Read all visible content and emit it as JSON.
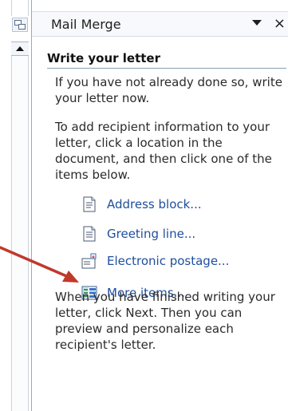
{
  "pane": {
    "title": "Mail Merge",
    "close_glyph": "×"
  },
  "section": {
    "title": "Write your letter"
  },
  "paragraphs": {
    "intro": "If you have not already done so, write your letter now.",
    "instructions": "To add recipient information to your letter, click a location in the document, and then click one of the items below.",
    "finish": "When you have finished writing your letter, click Next. Then you can preview and personalize each recipient's letter."
  },
  "items": [
    {
      "label": "Address block...",
      "icon": "address-block-icon"
    },
    {
      "label": "Greeting line...",
      "icon": "greeting-line-icon"
    },
    {
      "label": "Electronic postage...",
      "icon": "electronic-postage-icon"
    },
    {
      "label": "More items...",
      "icon": "more-items-icon"
    }
  ],
  "colors": {
    "link": "#1f4e9c",
    "arrow": "#c0392b",
    "rule": "#8c9fb9"
  }
}
